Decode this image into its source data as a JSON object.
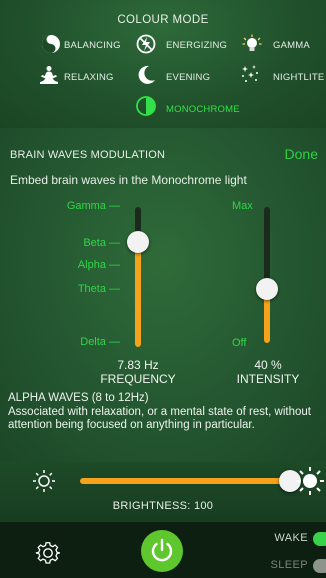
{
  "colour_mode": {
    "title": "COLOUR MODE",
    "modes": [
      {
        "label": "BALANCING",
        "icon": "yin-yang-icon"
      },
      {
        "label": "ENERGIZING",
        "icon": "lightning-icon"
      },
      {
        "label": "GAMMA",
        "icon": "bulb-icon"
      },
      {
        "label": "RELAXING",
        "icon": "meditation-icon"
      },
      {
        "label": "EVENING",
        "icon": "moon-icon"
      },
      {
        "label": "NIGHTLITE",
        "icon": "stars-icon"
      },
      {
        "label": "MONOCHROME",
        "icon": "half-circle-icon",
        "selected": true
      }
    ]
  },
  "brain_waves": {
    "title": "BRAIN WAVES MODULATION",
    "done_label": "Done",
    "subtitle": "Embed brain waves in the Monochrome light",
    "frequency": {
      "labels": [
        "Gamma —",
        "Beta —",
        "Alpha —",
        "Theta —",
        "Delta —"
      ],
      "value_text": "7.83 Hz",
      "caption": "FREQUENCY",
      "level": 0.75
    },
    "intensity": {
      "max_label": "Max",
      "off_label": "Off",
      "value_text": "40 %",
      "caption": "INTENSITY",
      "level": 0.4
    },
    "description_title": "ALPHA WAVES (8 to 12Hz)",
    "description": "Associated with relaxation, or a mental state of rest, without attention being focused on anything in particular."
  },
  "brightness": {
    "label": "BRIGHTNESS: 100",
    "level": 1.0
  },
  "footer": {
    "wake_label": "WAKE",
    "sleep_label": "SLEEP",
    "wake_on": true,
    "sleep_on": false
  },
  "colors": {
    "accent_green": "#30d648",
    "slider_orange": "#f6a21a",
    "power_green": "#5ec72e"
  }
}
